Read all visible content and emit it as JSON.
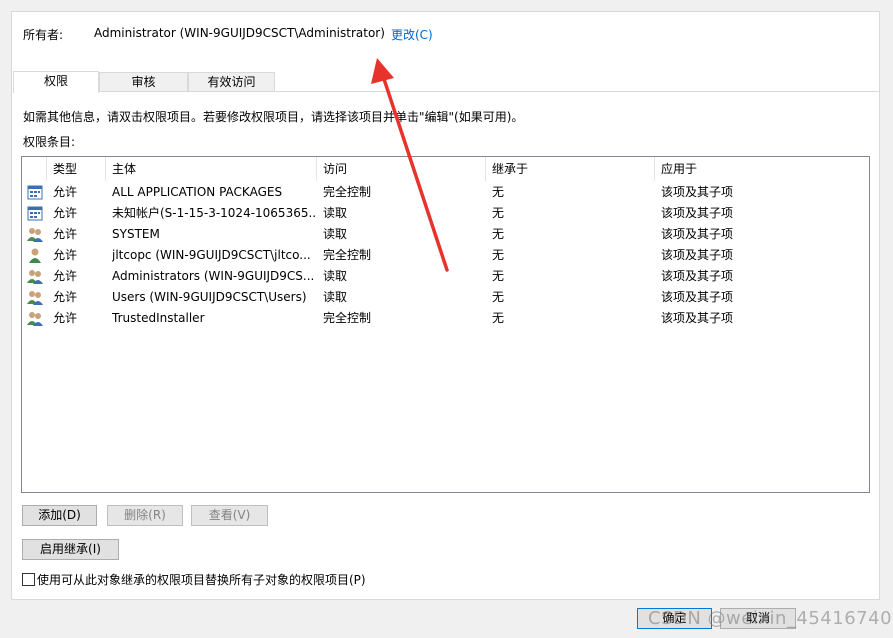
{
  "owner": {
    "label": "所有者:",
    "value": "Administrator (WIN-9GUIJD9CSCT\\Administrator)",
    "change_link": "更改(C)"
  },
  "tabs": [
    {
      "label": "权限",
      "active": true
    },
    {
      "label": "审核",
      "active": false
    },
    {
      "label": "有效访问",
      "active": false
    }
  ],
  "info_text": "如需其他信息，请双击权限项目。若要修改权限项目，请选择该项目并单击\"编辑\"(如果可用)。",
  "entries_label": "权限条目:",
  "columns": [
    "类型",
    "主体",
    "访问",
    "继承于",
    "应用于"
  ],
  "rows": [
    {
      "icon": "app-package-icon",
      "type": "允许",
      "principal": "ALL APPLICATION PACKAGES",
      "access": "完全控制",
      "inherited": "无",
      "applies": "该项及其子项"
    },
    {
      "icon": "app-package-icon",
      "type": "允许",
      "principal": "未知帐户(S-1-15-3-1024-1065365...",
      "access": "读取",
      "inherited": "无",
      "applies": "该项及其子项"
    },
    {
      "icon": "group-icon",
      "type": "允许",
      "principal": "SYSTEM",
      "access": "读取",
      "inherited": "无",
      "applies": "该项及其子项"
    },
    {
      "icon": "user-icon",
      "type": "允许",
      "principal": "jltcopc (WIN-9GUIJD9CSCT\\jltco...",
      "access": "完全控制",
      "inherited": "无",
      "applies": "该项及其子项"
    },
    {
      "icon": "group-icon",
      "type": "允许",
      "principal": "Administrators (WIN-9GUIJD9CS...",
      "access": "读取",
      "inherited": "无",
      "applies": "该项及其子项"
    },
    {
      "icon": "group-icon",
      "type": "允许",
      "principal": "Users (WIN-9GUIJD9CSCT\\Users)",
      "access": "读取",
      "inherited": "无",
      "applies": "该项及其子项"
    },
    {
      "icon": "group-icon",
      "type": "允许",
      "principal": "TrustedInstaller",
      "access": "完全控制",
      "inherited": "无",
      "applies": "该项及其子项"
    }
  ],
  "buttons": {
    "add": "添加(D)",
    "remove": "删除(R)",
    "view": "查看(V)",
    "enable_inheritance": "启用继承(I)",
    "ok": "确定",
    "cancel": "取消"
  },
  "replace_checkbox": {
    "label": "使用可从此对象继承的权限项目替换所有子对象的权限项目(P)",
    "checked": false
  },
  "watermark": "CSDN @weixin_45416740",
  "colors": {
    "link": "#0066cc",
    "annotation_arrow": "#e8322c"
  }
}
